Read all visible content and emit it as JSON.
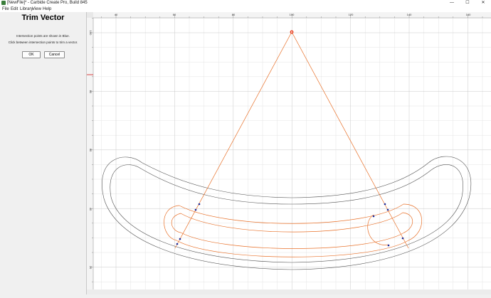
{
  "window": {
    "title": "[NewFile]* - Carbide Create Pro, Build 845"
  },
  "window_controls": [
    "—",
    "☐",
    "✕"
  ],
  "menu": [
    "File",
    "Edit",
    "Library",
    "View",
    "Help"
  ],
  "panel": {
    "title": "Trim Vector",
    "line1": "Intersection points are shown in Blue.",
    "line2": "Click between intersection points to trim a vector.",
    "ok": "OK",
    "cancel": "Cancel"
  },
  "ruler": {
    "top_labels": [
      "40",
      "60",
      "80",
      "100",
      "120",
      "140",
      "160"
    ],
    "left_labels": [
      "100",
      "80",
      "60",
      "40",
      "20"
    ]
  },
  "colors": {
    "selected_vector": "#e8712a",
    "vector": "#555555",
    "intersection": "#1a2a9a",
    "grid_minor": "#e4e4e4",
    "grid_major": "#c9c9c9",
    "ruler_marker": "#d94040"
  }
}
